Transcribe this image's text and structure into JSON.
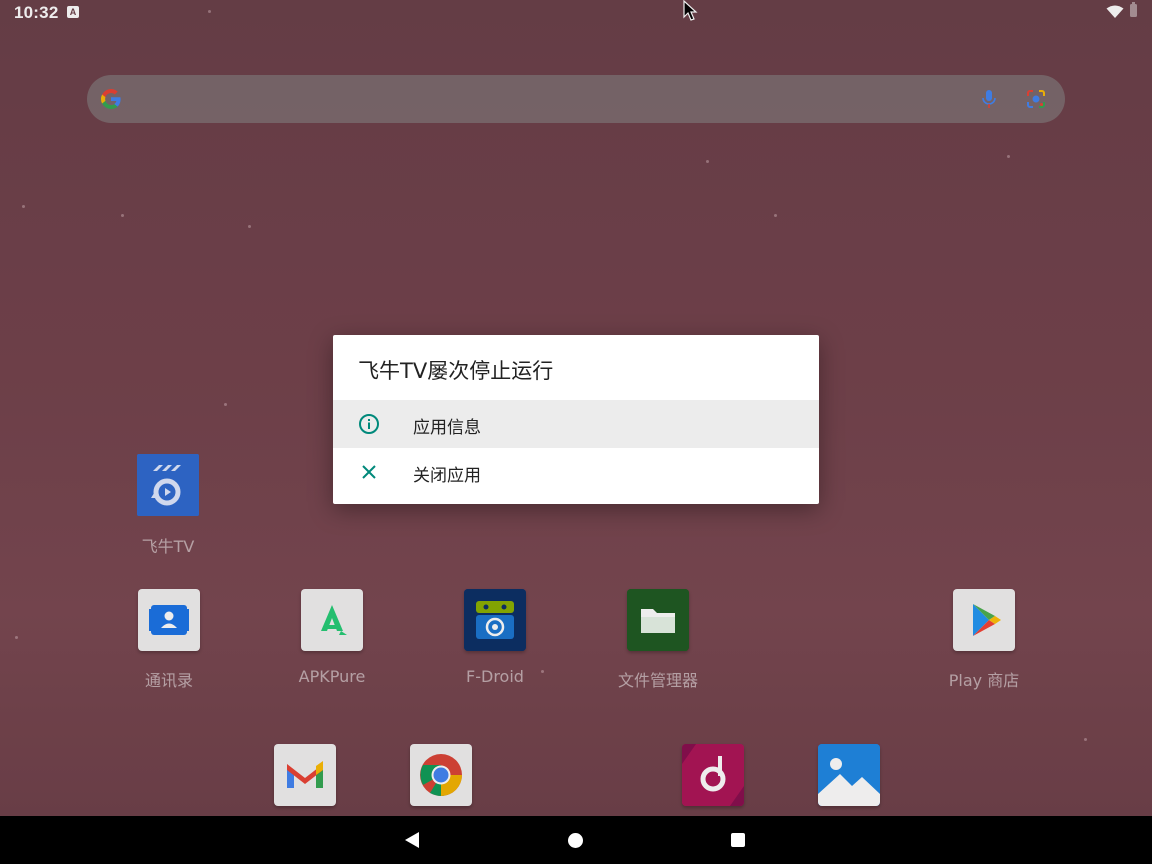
{
  "status_bar": {
    "time": "10:32",
    "notification_badge": "A",
    "icons": [
      "wifi-icon",
      "battery-icon"
    ]
  },
  "search_bar": {
    "icons": [
      "google-logo-icon",
      "mic-icon",
      "lens-icon"
    ]
  },
  "dialog": {
    "title": "飞牛TV屡次停止运行",
    "items": [
      {
        "label": "应用信息",
        "icon": "info-icon",
        "highlighted": true
      },
      {
        "label": "关闭应用",
        "icon": "close-icon",
        "highlighted": false
      }
    ],
    "accent_color": "#00897b",
    "highlight_color": "#ececec"
  },
  "apps": {
    "feiniu_tv": {
      "label": "飞牛TV",
      "icon": "feiniu-tv-icon"
    },
    "contacts": {
      "label": "通讯录",
      "icon": "contacts-icon"
    },
    "apkpure": {
      "label": "APKPure",
      "icon": "apkpure-icon"
    },
    "fdroid": {
      "label": "F-Droid",
      "icon": "fdroid-icon"
    },
    "files": {
      "label": "文件管理器",
      "icon": "files-icon"
    },
    "play_store": {
      "label": "Play 商店",
      "icon": "play-store-icon"
    }
  },
  "dock": [
    "gmail-icon",
    "chrome-icon",
    "music-icon",
    "gallery-icon"
  ],
  "nav_bar": [
    "back-button",
    "home-button",
    "recents-button"
  ]
}
